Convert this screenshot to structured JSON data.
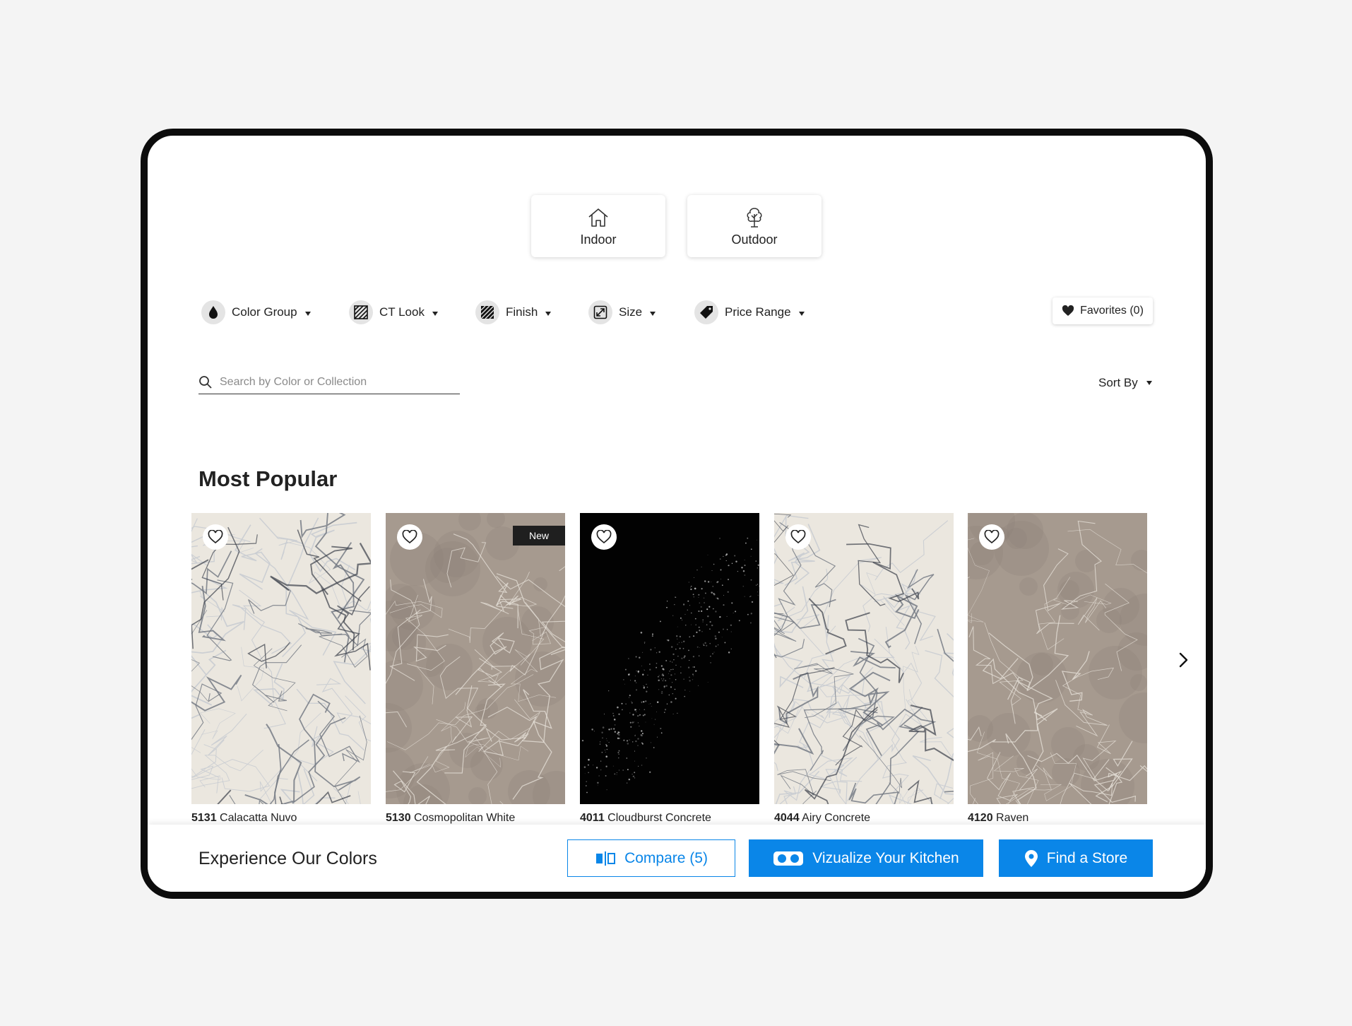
{
  "tabs": {
    "indoor_label": "Indoor",
    "outdoor_label": "Outdoor"
  },
  "filters": {
    "color_group": "Color Group",
    "ct_look": "CT Look",
    "finish": "Finish",
    "size": "Size",
    "price_range": "Price Range",
    "favorites_label": "Favorites (0)"
  },
  "search": {
    "placeholder": "Search by Color or Collection",
    "value": ""
  },
  "sort": {
    "label": "Sort By"
  },
  "section": {
    "title": "Most Popular"
  },
  "products": [
    {
      "code": "5131",
      "name": "Calacatta Nuvo",
      "badge": "",
      "texture": "white-marble"
    },
    {
      "code": "5130",
      "name": "Cosmopolitan White",
      "badge": "New",
      "texture": "taupe-marble"
    },
    {
      "code": "4011",
      "name": "Cloudburst Concrete",
      "badge": "",
      "texture": "black-speckle"
    },
    {
      "code": "4044",
      "name": "Airy Concrete",
      "badge": "",
      "texture": "white-marble"
    },
    {
      "code": "4120",
      "name": "Raven",
      "badge": "",
      "texture": "taupe-marble"
    }
  ],
  "bottom_bar": {
    "title": "Experience Our Colors",
    "compare_label": "Compare (5)",
    "visualize_label": "Vizualize Your Kitchen",
    "find_store_label": "Find a Store"
  },
  "colors": {
    "accent": "#0a86e8",
    "white_marble_base": "#ebe7df",
    "taupe_marble_base": "#a69a8f",
    "black_base": "#020202"
  },
  "icons": {
    "indoor": "house-icon",
    "outdoor": "tree-icon",
    "color_group": "water-drop-icon",
    "ct_look": "hatch-icon",
    "finish": "hatch-icon",
    "size": "resize-icon",
    "price_range": "price-tag-icon",
    "favorites": "heart-icon",
    "search": "search-icon",
    "next": "chevron-right-icon"
  }
}
